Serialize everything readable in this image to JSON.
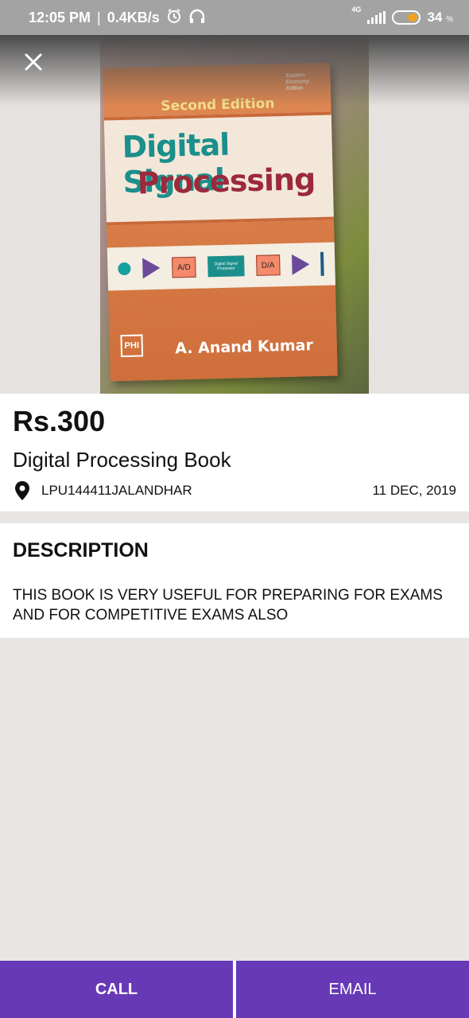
{
  "status_bar": {
    "time": "12:05 PM",
    "separator": "|",
    "speed": "0.4KB/s",
    "network": "4G",
    "battery": "34",
    "battery_unit": "%"
  },
  "photo": {
    "alt": "Book cover photo",
    "cover": {
      "edition": "Second Edition",
      "title_line1": "Digital Signal",
      "title_line2": "Processing",
      "block_ad": "A/D",
      "block_dsp": "Digital Signal Processor",
      "block_da": "D/A",
      "author": "A. Anand Kumar",
      "publisher": "PHI",
      "series": "Eastern Economy Edition"
    }
  },
  "listing": {
    "price": "Rs.300",
    "title": "Digital Processing Book",
    "location": "LPU144411JALANDHAR",
    "date": "11 DEC, 2019"
  },
  "description": {
    "heading": "DESCRIPTION",
    "text": "THIS BOOK IS VERY USEFUL FOR PREPARING FOR EXAMS AND FOR COMPETITIVE EXAMS ALSO"
  },
  "actions": {
    "call_label": "CALL",
    "email_label": "EMAIL"
  },
  "colors": {
    "accent": "#6739b6",
    "status_bar": "#a3a3a3",
    "background": "#e9e5e4"
  },
  "icons": {
    "close": "close-icon",
    "location": "location-pin-icon"
  }
}
